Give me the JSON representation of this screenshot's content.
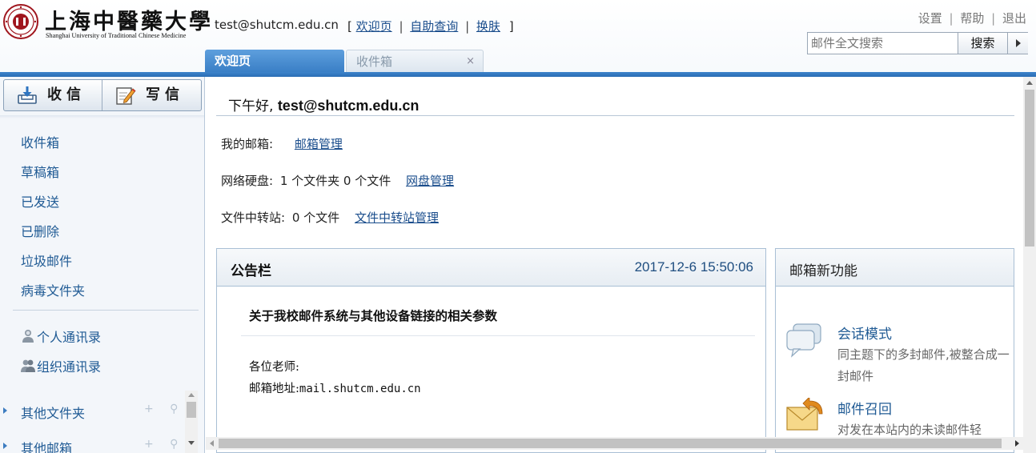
{
  "header": {
    "logo_title": "上海中醫藥大學",
    "logo_subtitle": "Shanghai University of Traditional Chinese Medicine",
    "user_email": "test@shutcm.edu.cn",
    "quick_links": {
      "open_bracket": "[",
      "welcome": "欢迎页",
      "self_query": "自助查询",
      "skin": "换肤",
      "close_bracket": "]",
      "separator": "|"
    },
    "top_links": {
      "settings": "设置",
      "help": "帮助",
      "logout": "退出",
      "separator": "|"
    },
    "search": {
      "placeholder": "邮件全文搜索",
      "button": "搜索"
    }
  },
  "tabs": [
    {
      "label": "欢迎页",
      "active": true
    },
    {
      "label": "收件箱",
      "active": false,
      "close": "×"
    }
  ],
  "sidebar": {
    "receive_label": "收信",
    "write_label": "写信",
    "folders": [
      "收件箱",
      "草稿箱",
      "已发送",
      "已删除",
      "垃圾邮件",
      "病毒文件夹"
    ],
    "contacts": [
      "个人通讯录",
      "组织通讯录"
    ],
    "sections": [
      {
        "label": "其他文件夹",
        "actions": "+ ⚲"
      },
      {
        "label": "其他邮箱",
        "actions": "+ ⚲"
      }
    ]
  },
  "main": {
    "greeting_prefix": "下午好,",
    "greeting_user": "test@shutcm.edu.cn",
    "my_mailbox_label": "我的邮箱:",
    "my_mailbox_link": "邮箱管理",
    "netdisk_label": "网络硬盘:",
    "netdisk_value": "1 个文件夹 0 个文件",
    "netdisk_link": "网盘管理",
    "transfer_label": "文件中转站:",
    "transfer_value": "0 个文件",
    "transfer_link": "文件中转站管理",
    "notice": {
      "title": "公告栏",
      "date": "2017-12-6 15:50:06",
      "subject": "关于我校邮件系统与其他设备链接的相关参数",
      "line1": "各位老师:",
      "line2_prefix": "邮箱地址:",
      "line2_value": "mail.shutcm.edu.cn"
    },
    "features": {
      "title": "邮箱新功能",
      "items": [
        {
          "name": "会话模式",
          "desc": "同主题下的多封邮件,被整合成一封邮件",
          "icon": "chat-bubbles-icon"
        },
        {
          "name": "邮件召回",
          "desc": "对发在本站内的未读邮件轻",
          "icon": "recall-envelope-icon"
        }
      ]
    }
  },
  "colors": {
    "accent_blue": "#3a7fc6",
    "link_blue": "#1f5a94",
    "date_blue": "#1f4e80"
  }
}
